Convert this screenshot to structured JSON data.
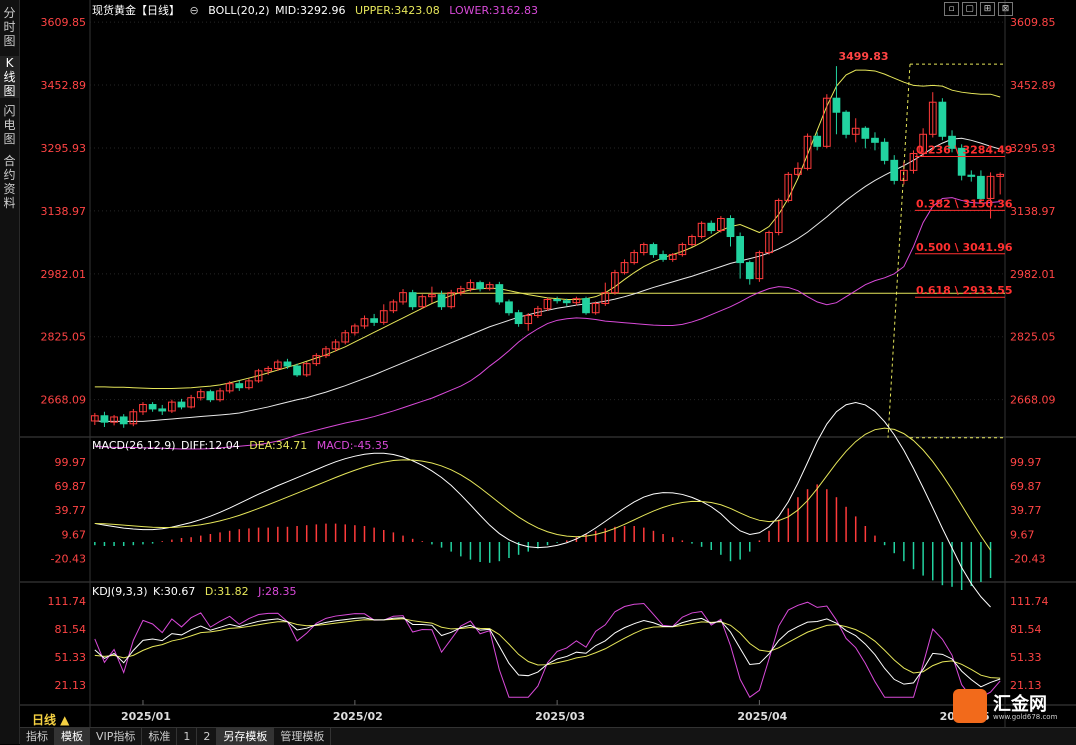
{
  "sidebar": {
    "tabs": [
      {
        "label": "分时图",
        "active": false
      },
      {
        "label": "K线图",
        "active": true
      },
      {
        "label": "闪电图",
        "active": false
      },
      {
        "label": "合约资料",
        "active": false
      }
    ]
  },
  "header": {
    "instrument": "现货黄金【日线】",
    "boll": {
      "label": "BOLL(20,2)",
      "mid": "MID:3292.96",
      "upper": "UPPER:3423.08",
      "lower": "LOWER:3162.83"
    }
  },
  "macd_legend": {
    "label": "MACD(26,12,9)",
    "diff": "DIFF:12.04",
    "dea": "DEA:34.71",
    "macd": "MACD:-45.35"
  },
  "kdj_legend": {
    "label": "KDJ(9,3,3)",
    "k": "K:30.67",
    "d": "D:31.82",
    "j": "J:28.35"
  },
  "timeframe_label": "日线 ▲",
  "toolbar": {
    "items": [
      {
        "label": "指标",
        "active": false
      },
      {
        "label": "模板",
        "active": true
      },
      {
        "label": "VIP指标",
        "active": false
      },
      {
        "label": "标准",
        "active": false
      },
      {
        "label": "1",
        "active": false
      },
      {
        "label": "2",
        "active": false
      },
      {
        "label": "另存模板",
        "active": true
      },
      {
        "label": "管理模板",
        "active": false
      }
    ]
  },
  "window_controls": [
    "▫",
    "▢",
    "⊞",
    "⊠"
  ],
  "logo": {
    "name": "汇金网",
    "url": "www.gold678.com"
  },
  "colors": {
    "up": "#ff3b3b",
    "down": "#22d3a0",
    "mid": "#e8e8e8",
    "upper": "#e6e65a",
    "lower": "#d94ad9",
    "axis_text": "#ff4444",
    "fib": "#ff3030",
    "fib_level": "#e6e65a",
    "grid": "#262626"
  },
  "chart_data": [
    {
      "type": "candlestick",
      "title": "现货黄金【日线】",
      "ylim": [
        2580,
        3640
      ],
      "y_ticks": [
        "3609.85",
        "3452.89",
        "3295.93",
        "3138.97",
        "2982.01",
        "2825.05",
        "2668.09"
      ],
      "x_labels": [
        "2025/01",
        "2025/02",
        "2025/03",
        "2025/04",
        "2025/05"
      ],
      "x_label_index": [
        5,
        27,
        48,
        69,
        90
      ],
      "peak_label": "3499.83",
      "candles": [
        [
          2615,
          2628,
          2605,
          2635
        ],
        [
          2628,
          2612,
          2600,
          2638
        ],
        [
          2612,
          2625,
          2604,
          2630
        ],
        [
          2625,
          2608,
          2598,
          2632
        ],
        [
          2608,
          2638,
          2602,
          2645
        ],
        [
          2638,
          2656,
          2630,
          2662
        ],
        [
          2656,
          2645,
          2638,
          2662
        ],
        [
          2645,
          2640,
          2630,
          2655
        ],
        [
          2640,
          2662,
          2635,
          2668
        ],
        [
          2662,
          2650,
          2644,
          2670
        ],
        [
          2650,
          2673,
          2646,
          2680
        ],
        [
          2673,
          2688,
          2666,
          2695
        ],
        [
          2688,
          2668,
          2662,
          2693
        ],
        [
          2668,
          2690,
          2663,
          2697
        ],
        [
          2690,
          2708,
          2684,
          2714
        ],
        [
          2708,
          2698,
          2690,
          2716
        ],
        [
          2698,
          2715,
          2693,
          2721
        ],
        [
          2715,
          2740,
          2710,
          2745
        ],
        [
          2740,
          2746,
          2730,
          2752
        ],
        [
          2746,
          2762,
          2740,
          2768
        ],
        [
          2762,
          2752,
          2745,
          2770
        ],
        [
          2752,
          2730,
          2725,
          2758
        ],
        [
          2730,
          2758,
          2725,
          2762
        ],
        [
          2758,
          2778,
          2752,
          2784
        ],
        [
          2778,
          2795,
          2772,
          2802
        ],
        [
          2795,
          2812,
          2788,
          2819
        ],
        [
          2812,
          2835,
          2806,
          2842
        ],
        [
          2835,
          2852,
          2828,
          2858
        ],
        [
          2852,
          2870,
          2845,
          2878
        ],
        [
          2870,
          2861,
          2852,
          2882
        ],
        [
          2861,
          2890,
          2855,
          2906
        ],
        [
          2890,
          2912,
          2884,
          2918
        ],
        [
          2912,
          2935,
          2905,
          2944
        ],
        [
          2935,
          2900,
          2892,
          2942
        ],
        [
          2900,
          2925,
          2895,
          2931
        ],
        [
          2925,
          2930,
          2910,
          2950
        ],
        [
          2930,
          2900,
          2892,
          2940
        ],
        [
          2900,
          2935,
          2895,
          2942
        ],
        [
          2935,
          2945,
          2928,
          2952
        ],
        [
          2945,
          2960,
          2938,
          2968
        ],
        [
          2960,
          2945,
          2938,
          2965
        ],
        [
          2945,
          2955,
          2940,
          2962
        ],
        [
          2955,
          2912,
          2905,
          2962
        ],
        [
          2912,
          2885,
          2878,
          2918
        ],
        [
          2885,
          2858,
          2850,
          2892
        ],
        [
          2858,
          2878,
          2840,
          2884
        ],
        [
          2878,
          2895,
          2872,
          2902
        ],
        [
          2895,
          2918,
          2890,
          2922
        ],
        [
          2918,
          2915,
          2908,
          2925
        ],
        [
          2915,
          2910,
          2902,
          2920
        ],
        [
          2910,
          2920,
          2903,
          2925
        ],
        [
          2920,
          2885,
          2880,
          2925
        ],
        [
          2885,
          2908,
          2880,
          2913
        ],
        [
          2908,
          2935,
          2902,
          2960
        ],
        [
          2935,
          2985,
          2930,
          2992
        ],
        [
          2985,
          3010,
          2980,
          3018
        ],
        [
          3010,
          3035,
          3005,
          3042
        ],
        [
          3035,
          3055,
          3028,
          3060
        ],
        [
          3055,
          3030,
          3022,
          3060
        ],
        [
          3030,
          3018,
          3012,
          3040
        ],
        [
          3018,
          3030,
          3012,
          3034
        ],
        [
          3030,
          3055,
          3025,
          3060
        ],
        [
          3055,
          3075,
          3050,
          3080
        ],
        [
          3075,
          3108,
          3070,
          3113
        ],
        [
          3108,
          3090,
          3082,
          3115
        ],
        [
          3090,
          3120,
          3085,
          3126
        ],
        [
          3120,
          3075,
          3050,
          3128
        ],
        [
          3075,
          3010,
          2970,
          3085
        ],
        [
          3010,
          2970,
          2955,
          3015
        ],
        [
          2970,
          3035,
          2962,
          3040
        ],
        [
          3035,
          3085,
          3030,
          3090
        ],
        [
          3085,
          3165,
          3078,
          3170
        ],
        [
          3165,
          3230,
          3160,
          3236
        ],
        [
          3230,
          3245,
          3225,
          3260
        ],
        [
          3245,
          3325,
          3240,
          3332
        ],
        [
          3325,
          3300,
          3290,
          3335
        ],
        [
          3300,
          3420,
          3295,
          3430
        ],
        [
          3420,
          3385,
          3330,
          3500
        ],
        [
          3385,
          3330,
          3320,
          3390
        ],
        [
          3330,
          3345,
          3310,
          3370
        ],
        [
          3345,
          3320,
          3295,
          3350
        ],
        [
          3320,
          3310,
          3290,
          3335
        ],
        [
          3310,
          3265,
          3255,
          3320
        ],
        [
          3265,
          3215,
          3205,
          3278
        ],
        [
          3215,
          3240,
          3205,
          3262
        ],
        [
          3240,
          3282,
          3232,
          3290
        ],
        [
          3282,
          3330,
          3275,
          3345
        ],
        [
          3330,
          3410,
          3322,
          3435
        ],
        [
          3410,
          3325,
          3315,
          3420
        ],
        [
          3325,
          3295,
          3285,
          3340
        ],
        [
          3295,
          3228,
          3215,
          3305
        ],
        [
          3228,
          3225,
          3212,
          3240
        ],
        [
          3225,
          3170,
          3160,
          3240
        ],
        [
          3170,
          3225,
          3120,
          3235
        ],
        [
          3225,
          3230,
          3180,
          3235
        ]
      ],
      "series": [
        {
          "name": "MID",
          "values": [
            2615,
            2614,
            2614,
            2614,
            2614,
            2614,
            2616,
            2618,
            2620,
            2622,
            2624,
            2626,
            2628,
            2630,
            2632,
            2635,
            2640,
            2645,
            2650,
            2656,
            2662,
            2668,
            2673,
            2680,
            2687,
            2695,
            2703,
            2712,
            2721,
            2730,
            2740,
            2750,
            2760,
            2770,
            2780,
            2790,
            2800,
            2810,
            2820,
            2830,
            2840,
            2850,
            2858,
            2866,
            2874,
            2880,
            2886,
            2891,
            2896,
            2900,
            2904,
            2907,
            2910,
            2914,
            2919,
            2925,
            2932,
            2940,
            2948,
            2955,
            2962,
            2969,
            2976,
            2984,
            2992,
            3000,
            3008,
            3014,
            3020,
            3026,
            3034,
            3044,
            3056,
            3070,
            3086,
            3105,
            3124,
            3145,
            3165,
            3183,
            3200,
            3215,
            3228,
            3240,
            3252,
            3265,
            3280,
            3296,
            3308,
            3318,
            3320,
            3315,
            3308,
            3300,
            3293
          ]
        },
        {
          "name": "UPPER",
          "values": [
            2700,
            2700,
            2699,
            2699,
            2698,
            2697,
            2696,
            2696,
            2696,
            2697,
            2698,
            2700,
            2702,
            2705,
            2710,
            2716,
            2722,
            2728,
            2735,
            2742,
            2749,
            2756,
            2764,
            2772,
            2780,
            2790,
            2800,
            2812,
            2824,
            2836,
            2848,
            2860,
            2872,
            2884,
            2896,
            2908,
            2918,
            2928,
            2936,
            2942,
            2945,
            2946,
            2945,
            2940,
            2935,
            2930,
            2926,
            2922,
            2920,
            2918,
            2918,
            2920,
            2925,
            2935,
            2950,
            2968,
            2985,
            3000,
            3012,
            3022,
            3030,
            3038,
            3048,
            3060,
            3075,
            3090,
            3100,
            3105,
            3095,
            3085,
            3100,
            3130,
            3170,
            3220,
            3280,
            3340,
            3400,
            3450,
            3478,
            3490,
            3490,
            3488,
            3480,
            3470,
            3460,
            3452,
            3450,
            3452,
            3450,
            3440,
            3435,
            3432,
            3430,
            3430,
            3423
          ]
        },
        {
          "name": "LOWER",
          "values": [
            2552,
            2550,
            2549,
            2549,
            2549,
            2548,
            2548,
            2547,
            2546,
            2545,
            2545,
            2545,
            2546,
            2548,
            2550,
            2552,
            2554,
            2556,
            2560,
            2565,
            2572,
            2580,
            2586,
            2592,
            2598,
            2604,
            2610,
            2615,
            2620,
            2626,
            2633,
            2640,
            2648,
            2656,
            2664,
            2672,
            2682,
            2692,
            2702,
            2715,
            2732,
            2752,
            2770,
            2790,
            2812,
            2830,
            2845,
            2858,
            2866,
            2870,
            2872,
            2871,
            2868,
            2864,
            2862,
            2860,
            2858,
            2856,
            2854,
            2853,
            2853,
            2856,
            2862,
            2870,
            2880,
            2890,
            2900,
            2912,
            2925,
            2936,
            2945,
            2950,
            2948,
            2940,
            2925,
            2912,
            2905,
            2910,
            2925,
            2940,
            2955,
            2965,
            2972,
            2982,
            3000,
            3050,
            3110,
            3150,
            3170,
            3172,
            3165,
            3160,
            3158,
            3160,
            3162
          ]
        }
      ]
    },
    {
      "type": "fibonacci",
      "levels": [
        {
          "label": "0.236 \\ 3284.49",
          "value": 3284.49
        },
        {
          "label": "0.382 \\ 3150.36",
          "value": 3150.36
        },
        {
          "label": "0.500 \\ 3041.96",
          "value": 3041.96
        },
        {
          "label": "0.618 \\ 2933.55",
          "value": 2933.55
        }
      ],
      "top": 3500,
      "bottom": 2578,
      "support_line": 2933.55
    },
    {
      "type": "bar",
      "title": "MACD(26,12,9)",
      "ylim": [
        -45,
        115
      ],
      "y_ticks": [
        "99.97",
        "69.87",
        "39.77",
        "9.67",
        "-20.43"
      ],
      "histogram": [
        -4,
        -5,
        -5,
        -5,
        -4,
        -3,
        -2,
        1,
        3,
        5,
        6,
        8,
        10,
        12,
        14,
        16,
        17,
        18,
        18,
        19,
        19,
        20,
        21,
        22,
        23,
        23,
        22,
        21,
        20,
        18,
        15,
        12,
        8,
        4,
        1,
        -3,
        -7,
        -12,
        -18,
        -22,
        -25,
        -26,
        -24,
        -20,
        -16,
        -12,
        -8,
        -4,
        -1,
        2,
        6,
        10,
        14,
        17,
        19,
        20,
        20,
        18,
        14,
        10,
        6,
        2,
        -2,
        -6,
        -10,
        -16,
        -24,
        -22,
        -12,
        2,
        14,
        28,
        42,
        56,
        66,
        72,
        66,
        56,
        44,
        32,
        20,
        8,
        -4,
        -14,
        -24,
        -34,
        -42,
        -48,
        -54,
        -56,
        -60,
        -55,
        -50,
        -45
      ]
    },
    {
      "type": "line",
      "title": "KDJ(9,3,3)",
      "ylim": [
        5,
        118
      ],
      "y_ticks": [
        "111.74",
        "81.54",
        "51.33",
        "21.13"
      ]
    }
  ]
}
